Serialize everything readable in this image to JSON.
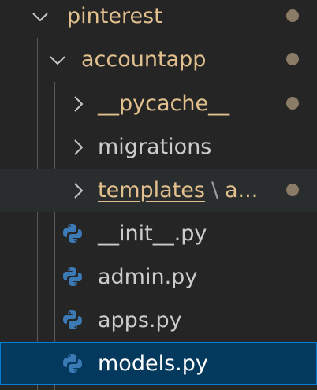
{
  "tree": {
    "items": [
      {
        "label": "pinterest",
        "kind": "folder",
        "expanded": true,
        "modified": true
      },
      {
        "label": "accountapp",
        "kind": "folder",
        "expanded": true,
        "modified": true
      },
      {
        "label": "__pycache__",
        "kind": "folder",
        "expanded": false,
        "modified": true
      },
      {
        "label": "migrations",
        "kind": "folder",
        "expanded": false,
        "modified": false
      },
      {
        "label": "templates",
        "compact_suffix": "a...",
        "kind": "folder",
        "expanded": false,
        "modified": true
      },
      {
        "label": "__init__.py",
        "kind": "file",
        "icon": "python-icon"
      },
      {
        "label": "admin.py",
        "kind": "file",
        "icon": "python-icon"
      },
      {
        "label": "apps.py",
        "kind": "file",
        "icon": "python-icon"
      },
      {
        "label": "models.py",
        "kind": "file",
        "icon": "python-icon",
        "selected": true
      }
    ],
    "compact_separator": "\\"
  },
  "colors": {
    "background": "#252526",
    "selection": "#04395e",
    "selection_border": "#007fd4",
    "modified_text": "#e2c08d",
    "normal_text": "#cccccc",
    "python_blue": "#3c7ab5"
  }
}
